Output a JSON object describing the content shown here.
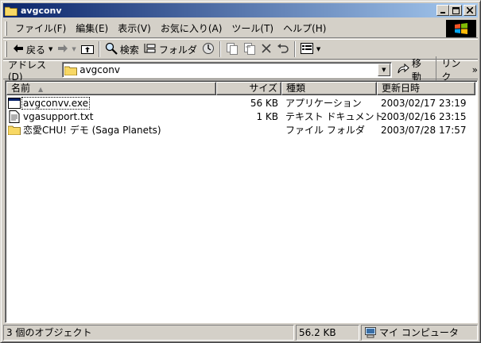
{
  "window": {
    "title": "avgconv"
  },
  "menu": {
    "items": [
      "ファイル(F)",
      "編集(E)",
      "表示(V)",
      "お気に入り(A)",
      "ツール(T)",
      "ヘルプ(H)"
    ]
  },
  "toolbar": {
    "back_label": "戻る",
    "search_label": "検索",
    "folders_label": "フォルダ"
  },
  "address": {
    "label": "アドレス(D)",
    "value": "avgconv",
    "go_label": "移動",
    "links_label": "リンク"
  },
  "columns": {
    "name": "名前",
    "size": "サイズ",
    "type": "種類",
    "modified": "更新日時"
  },
  "files": [
    {
      "name": "avgconvv.exe",
      "size": "56 KB",
      "type": "アプリケーション",
      "modified": "2003/02/17 23:19",
      "icon": "application-icon"
    },
    {
      "name": "vgasupport.txt",
      "size": "1 KB",
      "type": "テキスト ドキュメント",
      "modified": "2003/02/16 23:15",
      "icon": "text-document-icon"
    },
    {
      "name": "恋愛CHU! デモ (Saga Planets)",
      "size": "",
      "type": "ファイル フォルダ",
      "modified": "2003/07/28 17:57",
      "icon": "folder-icon"
    }
  ],
  "status": {
    "objects": "3 個のオブジェクト",
    "total_size": "56.2 KB",
    "zone": "マイ コンピュータ"
  },
  "colors": {
    "titlebar_start": "#0a246a",
    "titlebar_end": "#a6caf0",
    "chrome": "#d4d0c8"
  }
}
